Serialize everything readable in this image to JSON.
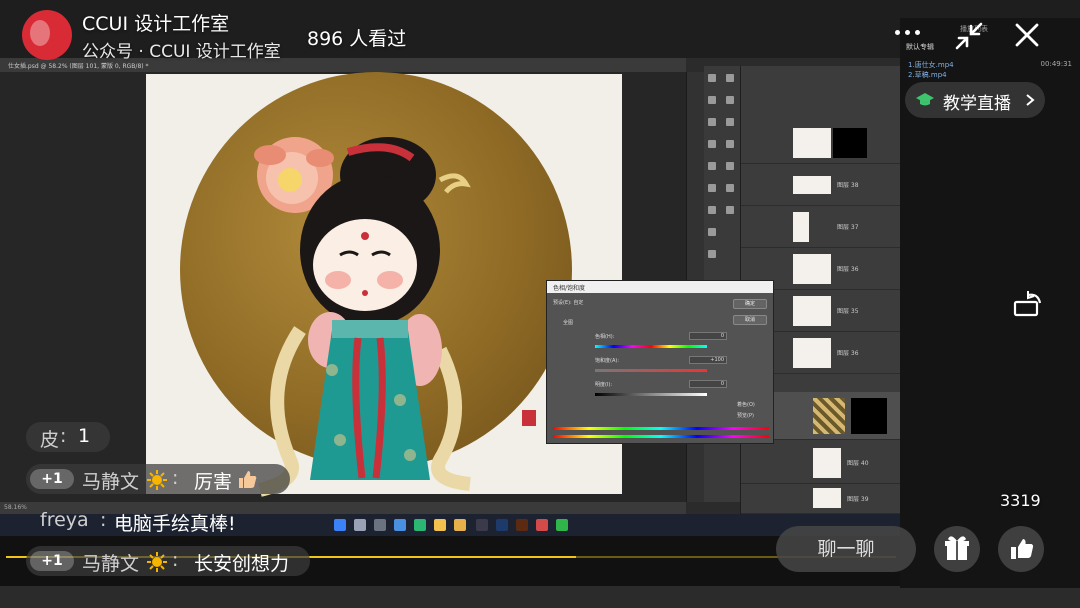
{
  "host": {
    "name": "CCUI 设计工作室",
    "subtitle": "公众号 · CCUI 设计工作室",
    "viewers": "896 人看过"
  },
  "top_actions": {
    "more": "more-icon",
    "shrink": "shrink-icon",
    "close": "close-icon"
  },
  "live_pill": {
    "label": "教学直播"
  },
  "comments": [
    {
      "badge": "",
      "user": "皮",
      "sep": ":",
      "msg": "1"
    },
    {
      "badge": "+1",
      "user": "马静文",
      "sep": ":",
      "msg": "厉害"
    },
    {
      "badge": "",
      "user": "freya",
      "sep": ":",
      "msg": "电脑手绘真棒!"
    },
    {
      "badge": "+1",
      "user": "马静文",
      "sep": ":",
      "msg": "长安创想力"
    }
  ],
  "like_count": "3319",
  "chat_button": "聊一聊",
  "video": {
    "ps_tab": "仕女插.psd @ 58.2% (图层 101, 蒙版 0, RGB/8) *",
    "ps_status": "58.16%",
    "dialog_title": "色相/饱和度",
    "dialog_preset": "预设(E): 自定",
    "dialog_channel": "全图",
    "hue_label": "色相(H):",
    "hue_value": "0",
    "sat_label": "饱和度(A):",
    "sat_value": "+100",
    "light_label": "明度(I):",
    "light_value": "0",
    "ok": "确定",
    "cancel": "取消",
    "colorize": "着色(O)",
    "preview": "预览(P)",
    "playlist_tab1": "默认专辑",
    "playlist_tab2": "播放列表",
    "playlist_item1": "1.唐仕女.mp4",
    "playlist_item2": "2.草稿.mp4",
    "playlist_time": "00:49:31",
    "layers": [
      "",
      "",
      "图层 38",
      "图层 37",
      "图层 36",
      "图层 35",
      "图层 36",
      "",
      "",
      "图层 40",
      "图层 39"
    ]
  },
  "colors": {
    "accent": "#f0c419",
    "avatar_red": "#d82b35"
  }
}
